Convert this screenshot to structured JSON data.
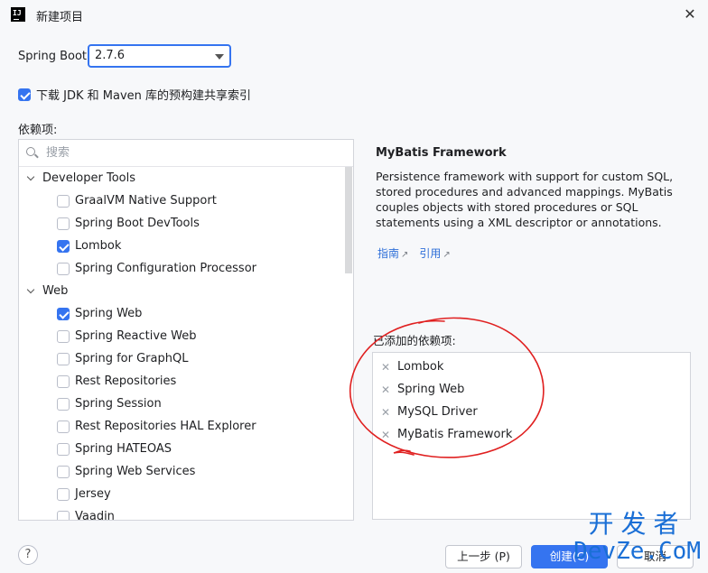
{
  "window": {
    "title": "新建项目",
    "close_icon": "close-icon"
  },
  "spring_boot": {
    "label": "Spring Boot:",
    "value": "2.7.6"
  },
  "jdk_option": {
    "label": "下载 JDK 和 Maven 库的预构建共享索引",
    "checked": true
  },
  "dependencies": {
    "label": "依赖项:",
    "search_placeholder": "搜索",
    "groups": [
      {
        "name": "Developer Tools",
        "items": [
          {
            "label": "GraalVM Native Support",
            "checked": false
          },
          {
            "label": "Spring Boot DevTools",
            "checked": false
          },
          {
            "label": "Lombok",
            "checked": true
          },
          {
            "label": "Spring Configuration Processor",
            "checked": false
          }
        ]
      },
      {
        "name": "Web",
        "items": [
          {
            "label": "Spring Web",
            "checked": true
          },
          {
            "label": "Spring Reactive Web",
            "checked": false
          },
          {
            "label": "Spring for GraphQL",
            "checked": false
          },
          {
            "label": "Rest Repositories",
            "checked": false
          },
          {
            "label": "Spring Session",
            "checked": false
          },
          {
            "label": "Rest Repositories HAL Explorer",
            "checked": false
          },
          {
            "label": "Spring HATEOAS",
            "checked": false
          },
          {
            "label": "Spring Web Services",
            "checked": false
          },
          {
            "label": "Jersey",
            "checked": false
          },
          {
            "label": "Vaadin",
            "checked": false
          }
        ]
      }
    ]
  },
  "description": {
    "title": "MyBatis Framework",
    "text": "Persistence framework with support for custom SQL, stored procedures and advanced mappings. MyBatis couples objects with stored procedures or SQL statements using a XML descriptor or annotations.",
    "link_guide": "指南",
    "link_ref": "引用",
    "link_arrow": "↗"
  },
  "added": {
    "label": "已添加的依赖项:",
    "items": [
      "Lombok",
      "Spring Web",
      "MySQL Driver",
      "MyBatis Framework"
    ]
  },
  "buttons": {
    "help": "?",
    "prev": "上一步 (P)",
    "create": "创建(C)",
    "cancel": "取消"
  },
  "watermark": {
    "top": "开发者",
    "bottom": "DevZe.CoM"
  },
  "colors": {
    "accent": "#3574f0",
    "annotation": "#e02020",
    "watermark": "#1a6fd6"
  }
}
